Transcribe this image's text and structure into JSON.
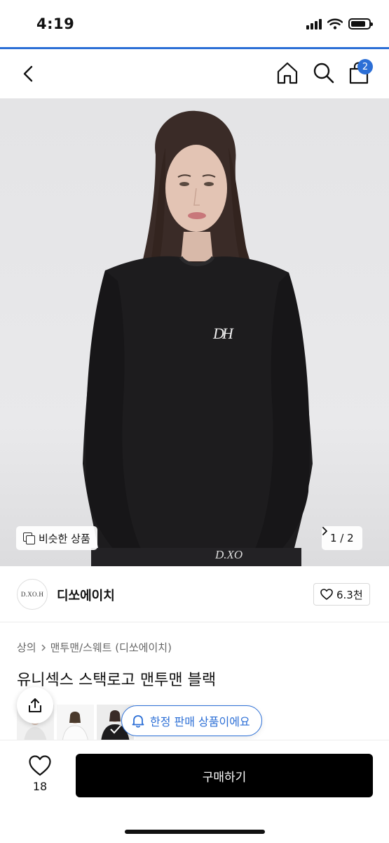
{
  "status": {
    "time": "4:19"
  },
  "nav": {
    "cart_count": "2"
  },
  "hero": {
    "similar_label": "비슷한 상품",
    "page_indicator": "1 / 2",
    "logo_mark": "DH",
    "logo_mark_lower": "D.XO"
  },
  "brand": {
    "logo_text": "D.XO.H",
    "name": "디쏘에이치",
    "like_count": "6.3천"
  },
  "product": {
    "breadcrumb": [
      "상의",
      "맨투맨/스웨트 (디쏘에이치)"
    ],
    "title": "유니섹스 스택로고 맨투맨 블랙"
  },
  "limited_label": "한정 판매 상품이에요",
  "bottom": {
    "wish_count": "18",
    "buy_label": "구매하기"
  },
  "colors": {
    "accent": "#2c6fd6",
    "buy_button": "#000000"
  },
  "icons": [
    "back-icon",
    "home-icon",
    "search-icon",
    "cart-icon",
    "heart-icon",
    "share-icon",
    "bell-icon",
    "chevron-right-icon"
  ]
}
